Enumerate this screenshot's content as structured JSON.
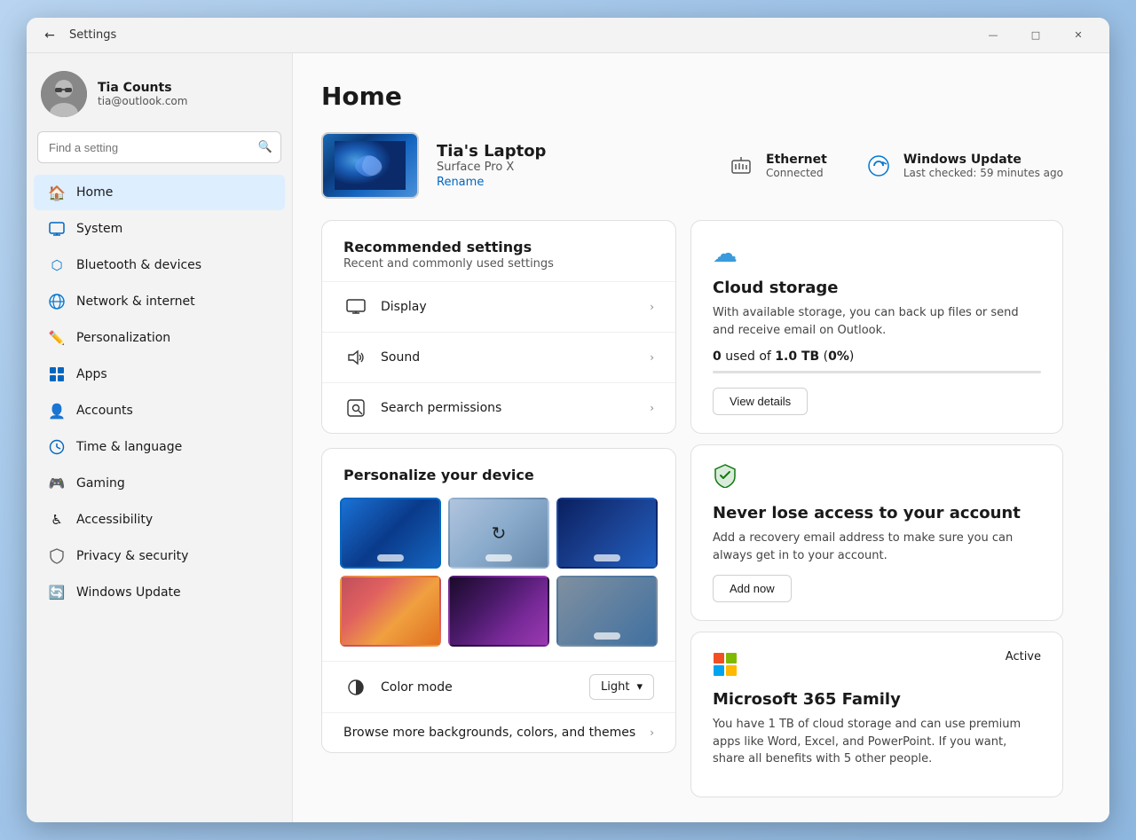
{
  "window": {
    "title": "Settings",
    "back_label": "←",
    "minimize": "—",
    "maximize": "□",
    "close": "✕"
  },
  "user": {
    "name": "Tia Counts",
    "email": "tia@outlook.com",
    "avatar_emoji": "👩"
  },
  "search": {
    "placeholder": "Find a setting"
  },
  "nav": [
    {
      "id": "home",
      "label": "Home",
      "icon": "🏠",
      "active": true
    },
    {
      "id": "system",
      "label": "System",
      "icon": "🖥"
    },
    {
      "id": "bluetooth",
      "label": "Bluetooth & devices",
      "icon": "📶"
    },
    {
      "id": "network",
      "label": "Network & internet",
      "icon": "🌐"
    },
    {
      "id": "personalization",
      "label": "Personalization",
      "icon": "✏️"
    },
    {
      "id": "apps",
      "label": "Apps",
      "icon": "📦"
    },
    {
      "id": "accounts",
      "label": "Accounts",
      "icon": "👤"
    },
    {
      "id": "time",
      "label": "Time & language",
      "icon": "🌍"
    },
    {
      "id": "gaming",
      "label": "Gaming",
      "icon": "🎮"
    },
    {
      "id": "accessibility",
      "label": "Accessibility",
      "icon": "♿"
    },
    {
      "id": "privacy",
      "label": "Privacy & security",
      "icon": "🛡"
    },
    {
      "id": "update",
      "label": "Windows Update",
      "icon": "🔄"
    }
  ],
  "page": {
    "title": "Home"
  },
  "device": {
    "name": "Tia's Laptop",
    "model": "Surface Pro X",
    "rename_label": "Rename"
  },
  "status_items": [
    {
      "id": "ethernet",
      "icon": "🔌",
      "title": "Ethernet",
      "sub": "Connected"
    },
    {
      "id": "windows_update",
      "icon": "🔄",
      "title": "Windows Update",
      "sub": "Last checked: 59 minutes ago"
    }
  ],
  "recommended": {
    "title": "Recommended settings",
    "subtitle": "Recent and commonly used settings",
    "rows": [
      {
        "id": "display",
        "icon": "🖥",
        "label": "Display"
      },
      {
        "id": "sound",
        "icon": "🔊",
        "label": "Sound"
      },
      {
        "id": "search_permissions",
        "icon": "📁",
        "label": "Search permissions"
      }
    ]
  },
  "personalize": {
    "title": "Personalize your device",
    "color_mode_label": "Color mode",
    "color_mode_value": "Light",
    "browse_label": "Browse more backgrounds, colors, and themes"
  },
  "cloud_storage": {
    "icon": "☁",
    "title": "Cloud storage",
    "desc": "With available storage, you can back up files or send and receive email on Outlook.",
    "used": "0",
    "total": "1.0 TB",
    "percent": "0%",
    "progress": 0,
    "btn_label": "View details"
  },
  "account_security": {
    "icon": "✔",
    "title": "Never lose access to your account",
    "desc": "Add a recovery email address to make sure you can always get in to your account.",
    "btn_label": "Add now"
  },
  "microsoft365": {
    "icon": "⊞",
    "title": "Microsoft 365 Family",
    "badge": "Active",
    "desc": "You have 1 TB of cloud storage and can use premium apps like Word, Excel, and PowerPoint. If you want, share all benefits with 5 other people."
  }
}
